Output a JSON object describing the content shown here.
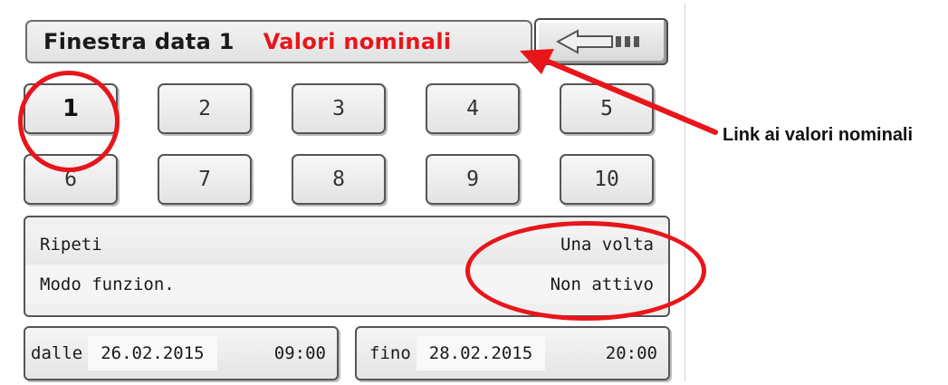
{
  "window": {
    "title": "Finestra data 1",
    "setpoint_link": "Valori nominali",
    "back_icon": "back-arrow-icon"
  },
  "slots": [
    "1",
    "2",
    "3",
    "4",
    "5",
    "6",
    "7",
    "8",
    "9",
    "10"
  ],
  "selected_slot": "1",
  "settings": [
    {
      "label": "Ripeti",
      "value": "Una volta"
    },
    {
      "label": "Modo funzion.",
      "value": "Non attivo"
    }
  ],
  "from": {
    "label": "dalle",
    "date": "26.02.2015",
    "time": "09:00"
  },
  "to": {
    "label": "fino",
    "date": "28.02.2015",
    "time": "20:00"
  },
  "annotation": {
    "label": "Link ai valori nominali",
    "color": "#e8151b"
  }
}
